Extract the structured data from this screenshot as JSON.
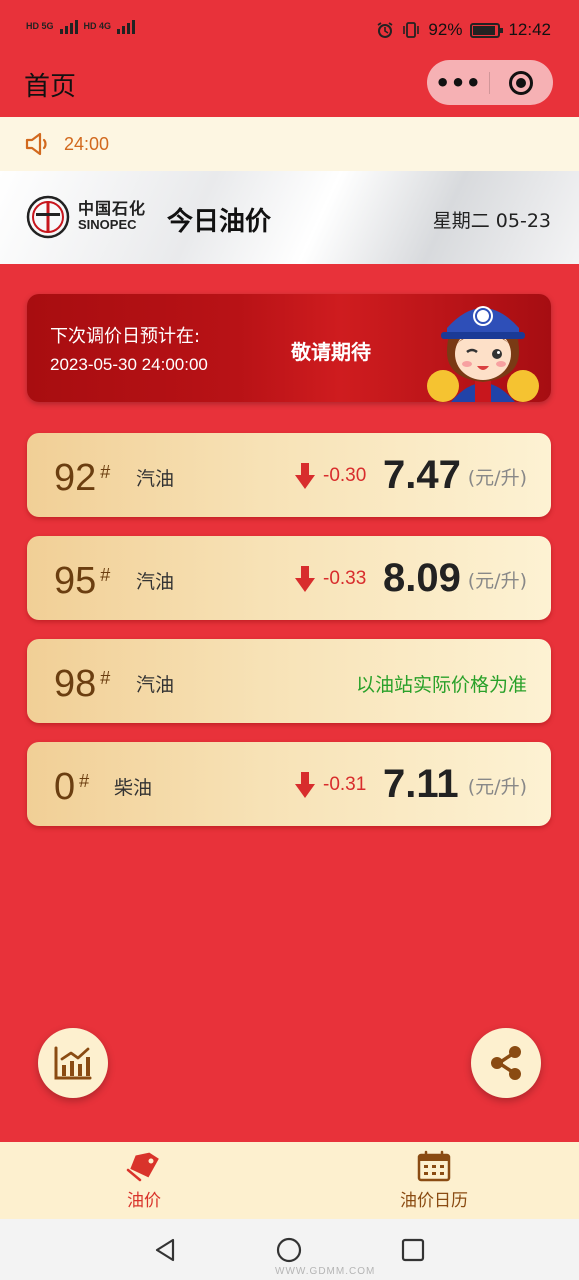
{
  "status_bar": {
    "sim1": "HD 5G",
    "sim2": "HD 4G",
    "battery": "92%",
    "time": "12:42"
  },
  "nav": {
    "title": "首页",
    "more_label": "•••"
  },
  "notice": {
    "text": "24:00"
  },
  "banner": {
    "logo_cn": "中国石化",
    "logo_en": "SINOPEC",
    "title": "今日油价",
    "date": "星期二 05-23"
  },
  "next_adjust": {
    "label": "下次调价日预计在:",
    "datetime": "2023-05-30 24:00:00",
    "status": "敬请期待"
  },
  "prices": [
    {
      "grade": "92",
      "mark": "#",
      "type": "汽油",
      "change": "-0.30",
      "price": "7.47",
      "unit": "(元/升)"
    },
    {
      "grade": "95",
      "mark": "#",
      "type": "汽油",
      "change": "-0.33",
      "price": "8.09",
      "unit": "(元/升)"
    },
    {
      "grade": "98",
      "mark": "#",
      "type": "汽油",
      "note": "以油站实际价格为准"
    },
    {
      "grade": "0",
      "mark": "#",
      "type": "柴油",
      "change": "-0.31",
      "price": "7.11",
      "unit": "(元/升)"
    }
  ],
  "tabs": [
    {
      "label": "油价",
      "active": true,
      "icon": "price-tag-icon"
    },
    {
      "label": "油价日历",
      "active": false,
      "icon": "calendar-icon"
    }
  ],
  "colors": {
    "background": "#e8323a",
    "card_gold": "#f7e2b6",
    "down": "#d82d2d",
    "note_green": "#2aa12a",
    "tab_active": "#d9332b",
    "tab_inactive": "#8a4b12"
  },
  "watermark": "WWW.GDMM.COM"
}
